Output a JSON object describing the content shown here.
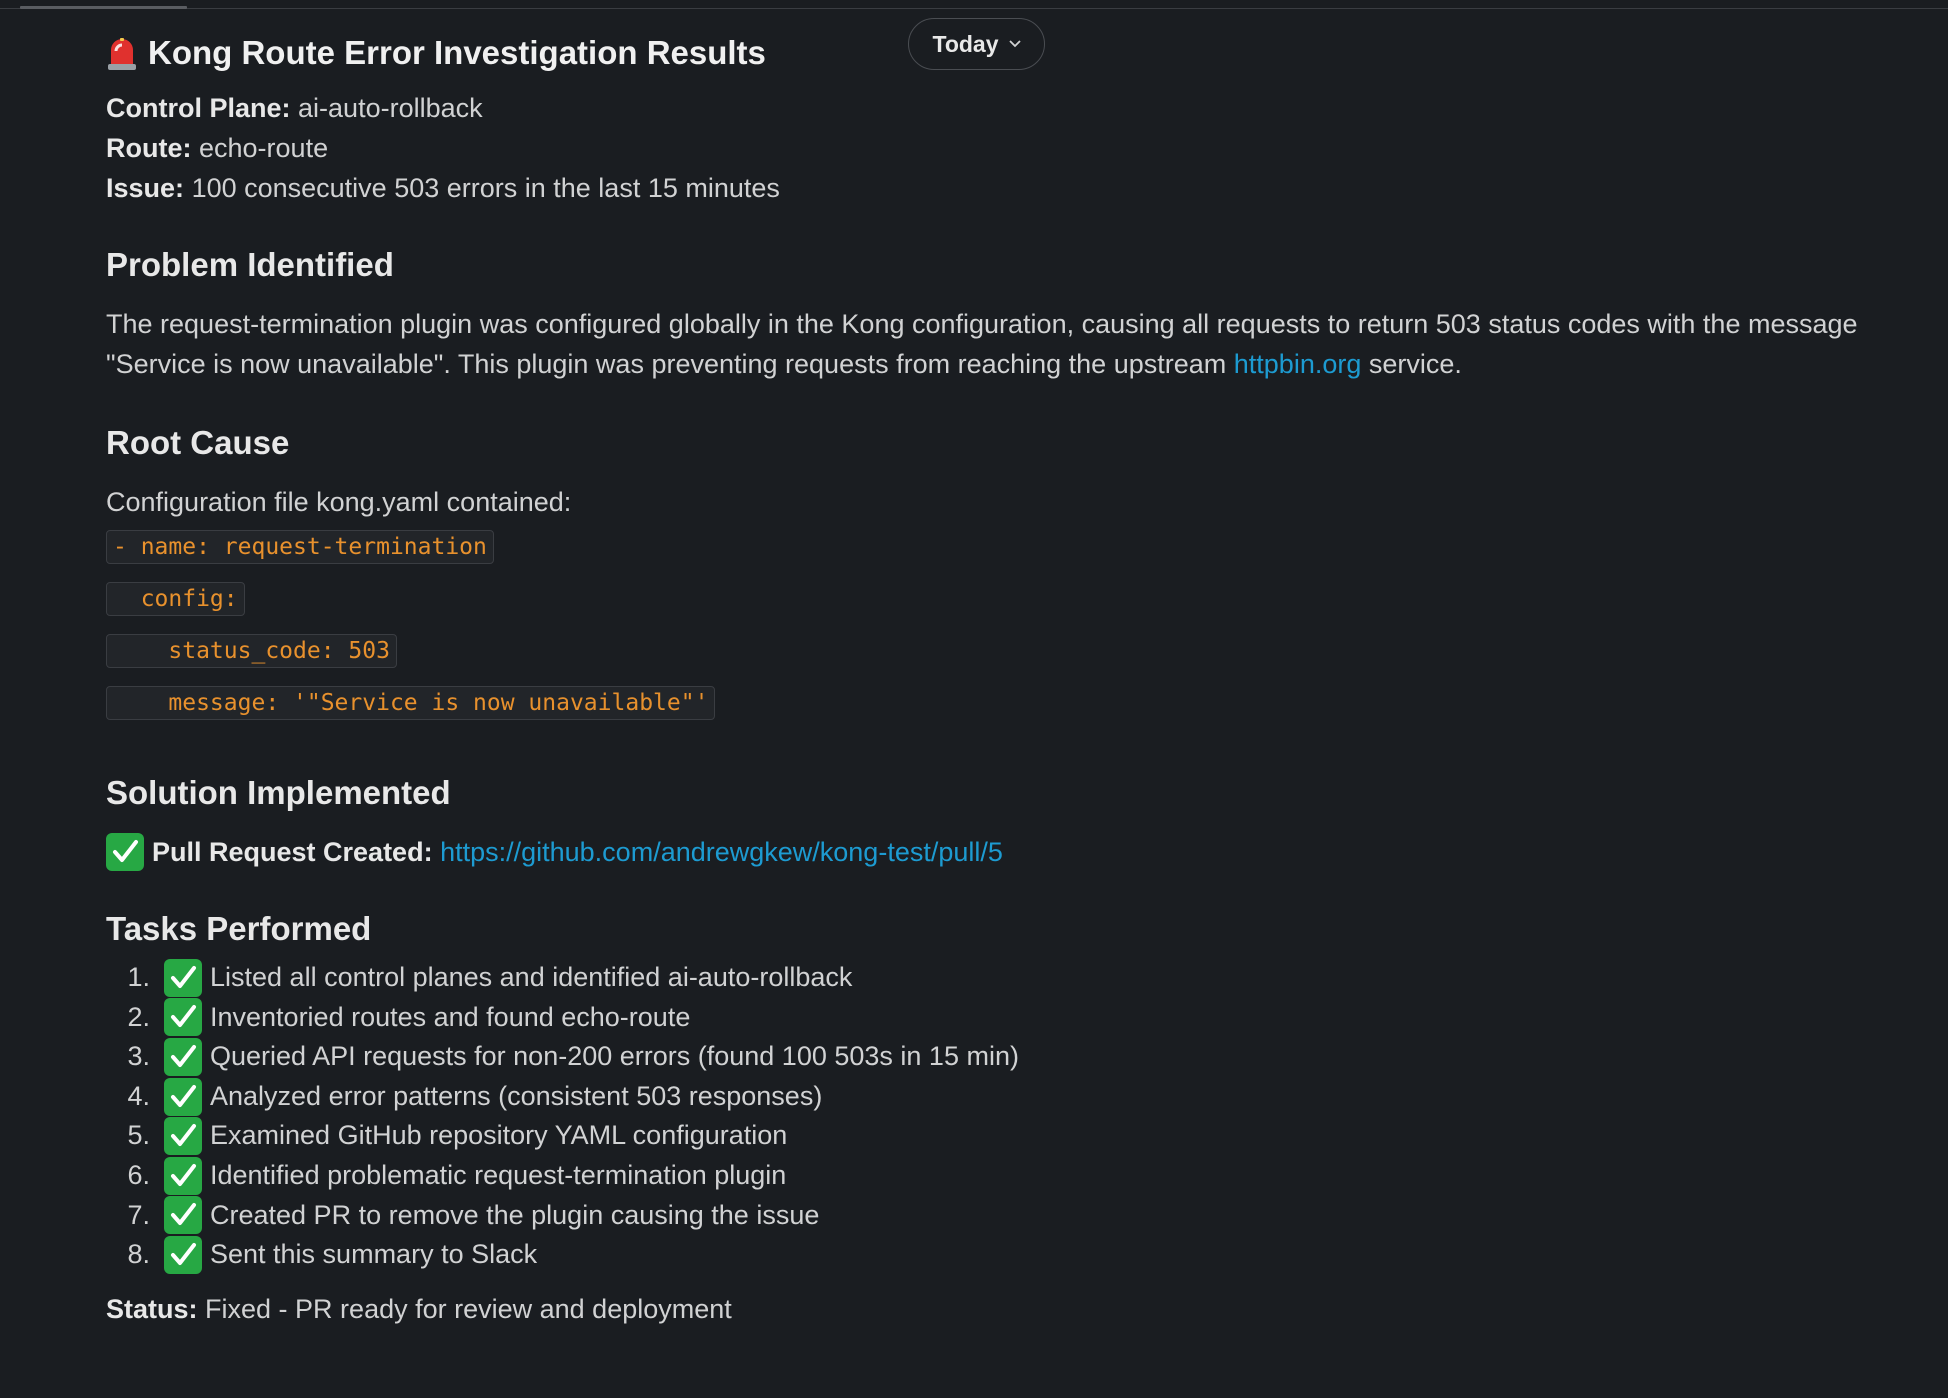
{
  "header": {
    "date_pill_label": "Today"
  },
  "message": {
    "title": "Kong Route Error Investigation Results",
    "title_icon": "rotating-light-icon",
    "meta": [
      {
        "label": "Control Plane:",
        "value": "ai-auto-rollback"
      },
      {
        "label": "Route:",
        "value": "echo-route"
      },
      {
        "label": "Issue:",
        "value": "100 consecutive 503 errors in the last 15 minutes"
      }
    ],
    "problem": {
      "heading": "Problem Identified",
      "text_1": "The request-termination plugin was configured globally in the Kong configuration, causing all requests to return 503 status codes with the message \"Service is now unavailable\". This plugin was preventing requests from reaching the upstream ",
      "link": "httpbin.org",
      "text_2": " service."
    },
    "root_cause": {
      "heading": "Root Cause",
      "intro": "Configuration file kong.yaml contained:",
      "code_lines": [
        "- name: request-termination",
        "  config:",
        "    status_code: 503",
        "    message: '\"Service is now unavailable\"'"
      ]
    },
    "solution": {
      "heading": "Solution Implemented",
      "label": "Pull Request Created:",
      "link": "https://github.com/andrewgkew/kong-test/pull/5"
    },
    "tasks": {
      "heading": "Tasks Performed",
      "items": [
        {
          "num": "1.",
          "text": "Listed all control planes and identified ai-auto-rollback"
        },
        {
          "num": "2.",
          "text": "Inventoried routes and found echo-route"
        },
        {
          "num": "3.",
          "text": "Queried API requests for non-200 errors (found 100 503s in 15 min)"
        },
        {
          "num": "4.",
          "text": "Analyzed error patterns (consistent 503 responses)"
        },
        {
          "num": "5.",
          "text": "Examined GitHub repository YAML configuration"
        },
        {
          "num": "6.",
          "text": "Identified problematic request-termination plugin"
        },
        {
          "num": "7.",
          "text": "Created PR to remove the plugin causing the issue"
        },
        {
          "num": "8.",
          "text": "Sent this summary to Slack"
        }
      ]
    },
    "status": {
      "label": "Status:",
      "value": "Fixed - PR ready for review and deployment"
    }
  },
  "colors": {
    "background": "#1a1d21",
    "link": "#1d9bd1",
    "code_text": "#e8912d",
    "check_green": "#27a844"
  }
}
